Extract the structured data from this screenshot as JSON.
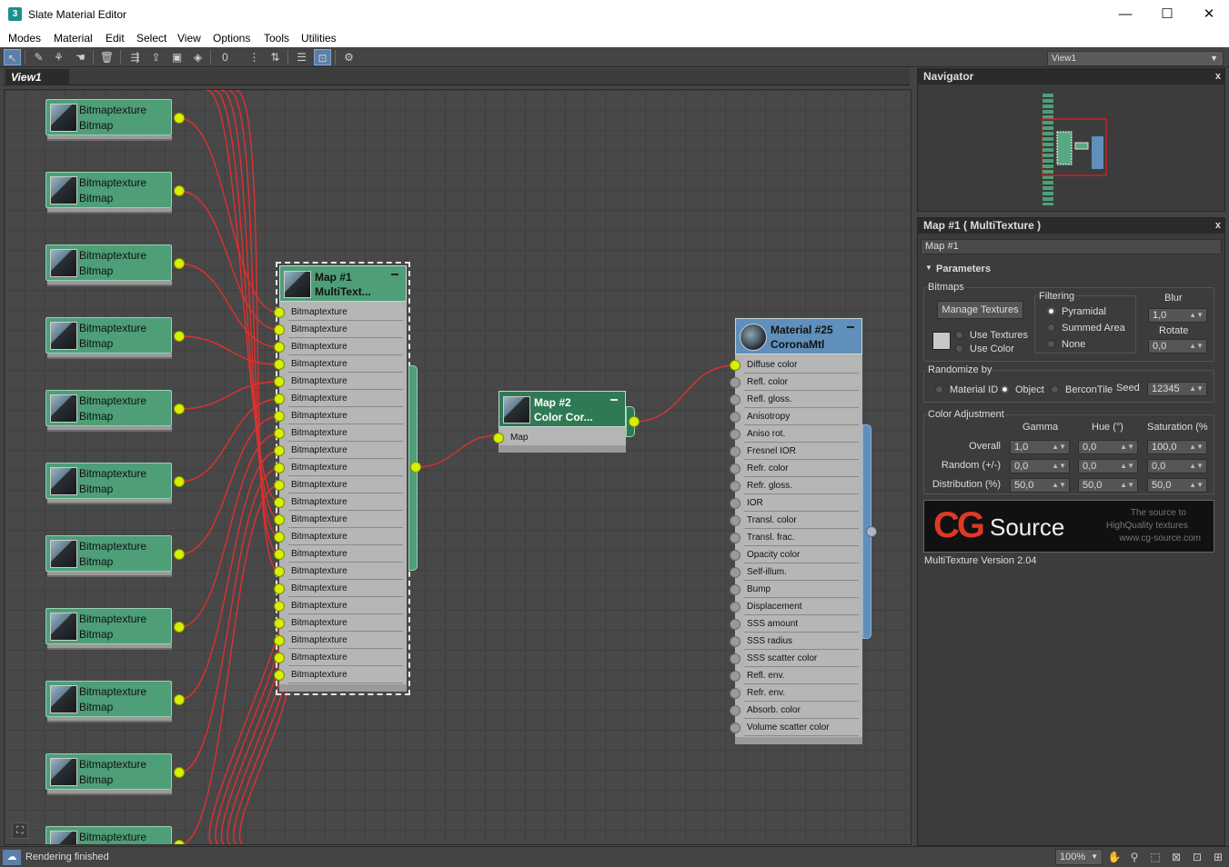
{
  "window": {
    "title": "Slate Material Editor",
    "app_icon": "3",
    "minimize": "—",
    "maximize": "☐",
    "close": "✕"
  },
  "menu": [
    "Modes",
    "Material",
    "Edit",
    "Select",
    "View",
    "Options",
    "Tools",
    "Utilities"
  ],
  "toolbar": {
    "view_select": "View1"
  },
  "view": {
    "tab": "View1"
  },
  "bitmap_nodes": [
    {
      "title": "Bitmaptexture",
      "subtitle": "Bitmap"
    },
    {
      "title": "Bitmaptexture",
      "subtitle": "Bitmap"
    },
    {
      "title": "Bitmaptexture",
      "subtitle": "Bitmap"
    },
    {
      "title": "Bitmaptexture",
      "subtitle": "Bitmap"
    },
    {
      "title": "Bitmaptexture",
      "subtitle": "Bitmap"
    },
    {
      "title": "Bitmaptexture",
      "subtitle": "Bitmap"
    },
    {
      "title": "Bitmaptexture",
      "subtitle": "Bitmap"
    },
    {
      "title": "Bitmaptexture",
      "subtitle": "Bitmap"
    },
    {
      "title": "Bitmaptexture",
      "subtitle": "Bitmap"
    },
    {
      "title": "Bitmaptexture",
      "subtitle": "Bitmap"
    },
    {
      "title": "Bitmaptexture",
      "subtitle": ""
    }
  ],
  "multitexture_node": {
    "title": "Map #1",
    "subtitle": "MultiText...",
    "slots": [
      "Bitmaptexture",
      "Bitmaptexture",
      "Bitmaptexture",
      "Bitmaptexture",
      "Bitmaptexture",
      "Bitmaptexture",
      "Bitmaptexture",
      "Bitmaptexture",
      "Bitmaptexture",
      "Bitmaptexture",
      "Bitmaptexture",
      "Bitmaptexture",
      "Bitmaptexture",
      "Bitmaptexture",
      "Bitmaptexture",
      "Bitmaptexture",
      "Bitmaptexture",
      "Bitmaptexture",
      "Bitmaptexture",
      "Bitmaptexture",
      "Bitmaptexture",
      "Bitmaptexture"
    ]
  },
  "colorcorrect_node": {
    "title": "Map #2",
    "subtitle": "Color Cor...",
    "slots": [
      "Map"
    ]
  },
  "material_node": {
    "title": "Material #25",
    "subtitle": "CoronaMtl",
    "slots": [
      "Diffuse color",
      "Refl. color",
      "Refl. gloss.",
      "Anisotropy",
      "Aniso rot.",
      "Fresnel IOR",
      "Refr. color",
      "Refr. gloss.",
      "IOR",
      "Transl. color",
      "Transl. frac.",
      "Opacity color",
      "Self-illum.",
      "Bump",
      "Displacement",
      "SSS amount",
      "SSS radius",
      "SSS scatter color",
      "Refl. env.",
      "Refr. env.",
      "Absorb. color",
      "Volume scatter color"
    ]
  },
  "navigator": {
    "title": "Navigator",
    "close": "x"
  },
  "params": {
    "title": "Map #1  ( MultiTexture )",
    "close": "x",
    "name_field": "Map #1",
    "section": "Parameters",
    "bitmaps_label": "Bitmaps",
    "manage_textures": "Manage Textures",
    "use_textures": "Use Textures",
    "use_color": "Use Color",
    "filtering_label": "Filtering",
    "filter_pyramidal": "Pyramidal",
    "filter_summed": "Summed Area",
    "filter_none": "None",
    "blur_label": "Blur",
    "blur_value": "1,0",
    "rotate_label": "Rotate",
    "rotate_value": "0,0",
    "randomize_label": "Randomize by",
    "rand_material_id": "Material ID",
    "rand_object": "Object",
    "rand_bercon": "BerconTile",
    "seed_label": "Seed",
    "seed_value": "12345",
    "color_adj_label": "Color Adjustment",
    "col_gamma": "Gamma",
    "col_hue": "Hue (°)",
    "col_saturation": "Saturation (%",
    "rows": [
      {
        "label": "Overall",
        "gamma": "1,0",
        "hue": "0,0",
        "sat": "100,0"
      },
      {
        "label": "Random (+/-)",
        "gamma": "0,0",
        "hue": "0,0",
        "sat": "0,0"
      },
      {
        "label": "Distribution (%)",
        "gamma": "50,0",
        "hue": "50,0",
        "sat": "50,0"
      }
    ],
    "logo_cg": "CG",
    "logo_source": "Source",
    "logo_tag1": "The source to",
    "logo_tag2": "HighQuality textures",
    "logo_tag3": "www.cg-source.com",
    "version": "MultiTexture Version 2.04"
  },
  "status": {
    "text": "Rendering finished",
    "zoom": "100%"
  },
  "colors": {
    "bitmap_header": "#4e9e78",
    "multitexture_header": "#4e9e78",
    "colorcorrect_header": "#2f7a55",
    "material_header": "#5f8fba",
    "wire": "#e03030",
    "socket": "#d8f000"
  }
}
